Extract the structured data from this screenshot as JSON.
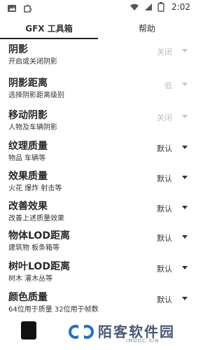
{
  "statusbar": {
    "time": "2:02",
    "left_icons": [
      "image-icon",
      "puzzle-icon"
    ],
    "right_icons": [
      "wifi-icon",
      "signal-icon",
      "battery-icon"
    ]
  },
  "tabs": [
    {
      "label": "GFX 工具箱",
      "active": true
    },
    {
      "label": "帮助",
      "active": false
    }
  ],
  "settings": [
    {
      "title": "阴影",
      "desc": "开启或关闭阴影",
      "value": "关闭",
      "enabled": false
    },
    {
      "title": "阴影距离",
      "desc": "选择阴影距离级别",
      "value": "低",
      "enabled": false
    },
    {
      "title": "移动阴影",
      "desc": "人物及车辆阴影",
      "value": "关闭",
      "enabled": false
    },
    {
      "title": "纹理质量",
      "desc": "物品 车辆等",
      "value": "默认",
      "enabled": true
    },
    {
      "title": "效果质量",
      "desc": "火花 爆炸 射击等",
      "value": "默认",
      "enabled": true
    },
    {
      "title": "改善效果",
      "desc": "改善上述质量效果",
      "value": "默认",
      "enabled": true
    },
    {
      "title": "物体LOD距离",
      "desc": "建筑物 板条箱等",
      "value": "默认",
      "enabled": true
    },
    {
      "title": "树叶LOD距离",
      "desc": "树木 灌木丛等",
      "value": "默认",
      "enabled": true
    },
    {
      "title": "颜色质量",
      "desc": "64位用于质量 32位用于帧数",
      "value": "默认",
      "enabled": true
    }
  ],
  "watermark": {
    "text": "陌客软件园",
    "sub": "IMOOC.XIN"
  },
  "colors": {
    "disabled": "#bdbdbd",
    "text": "#222222",
    "watermark": "#4b5a73"
  }
}
